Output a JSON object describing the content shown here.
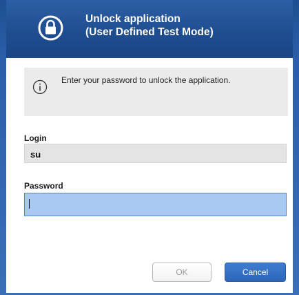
{
  "header": {
    "title_line1": "Unlock application",
    "title_line2": "(User Defined Test Mode)",
    "icon": "lock-icon"
  },
  "info": {
    "icon": "info-icon",
    "message": "Enter your password to unlock the application."
  },
  "form": {
    "login_label": "Login",
    "login_value": "su",
    "password_label": "Password",
    "password_value": ""
  },
  "buttons": {
    "ok_label": "OK",
    "cancel_label": "Cancel"
  },
  "colors": {
    "header_blue": "#1f4e90",
    "password_focus": "#a9c8f2",
    "cancel_blue": "#2d66b9"
  }
}
